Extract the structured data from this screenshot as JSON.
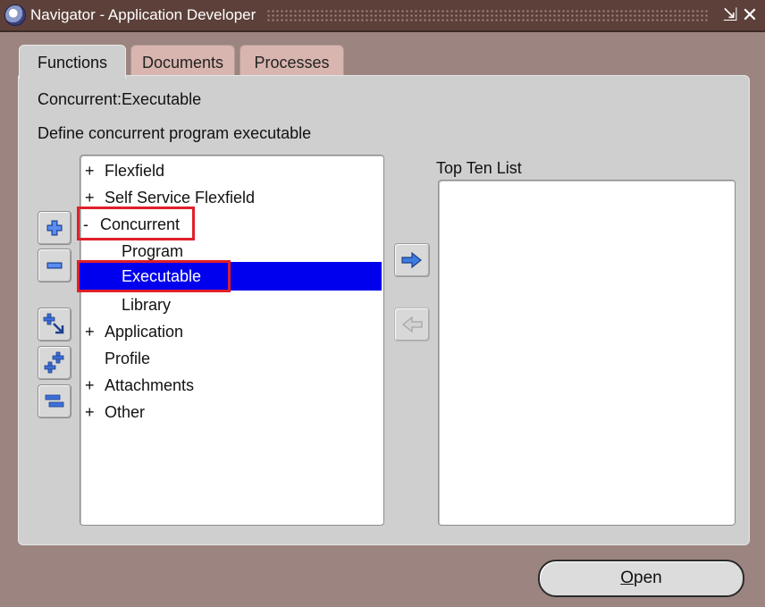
{
  "window": {
    "title": "Navigator - Application Developer",
    "minimize_glyph": "⇲",
    "close_glyph": "✕"
  },
  "tabs": [
    {
      "label": "Functions",
      "active": true
    },
    {
      "label": "Documents",
      "active": false
    },
    {
      "label": "Processes",
      "active": false
    }
  ],
  "function_name": "Concurrent:Executable",
  "function_description": "Define concurrent program executable",
  "tree": {
    "items": [
      {
        "prefix": "+",
        "label": "Flexfield",
        "level": 0
      },
      {
        "prefix": "+",
        "label": "Self Service Flexfield",
        "level": 0
      },
      {
        "prefix": "-",
        "label": "Concurrent",
        "level": 0,
        "highlighted": true
      },
      {
        "prefix": "",
        "label": "Program",
        "level": 1
      },
      {
        "prefix": "",
        "label": "Executable",
        "level": 1,
        "selected": true,
        "highlighted": true
      },
      {
        "prefix": "",
        "label": "Library",
        "level": 1
      },
      {
        "prefix": "+",
        "label": "Application",
        "level": 0
      },
      {
        "prefix": "",
        "label": "Profile",
        "level": 0
      },
      {
        "prefix": "+",
        "label": "Attachments",
        "level": 0
      },
      {
        "prefix": "+",
        "label": "Other",
        "level": 0
      }
    ]
  },
  "side_buttons": [
    {
      "name": "expand-button",
      "icon": "plus-icon"
    },
    {
      "name": "collapse-button",
      "icon": "minus-icon"
    },
    {
      "name": "expand-branch-button",
      "icon": "expand-branch-icon"
    },
    {
      "name": "expand-all-button",
      "icon": "expand-all-icon"
    },
    {
      "name": "collapse-all-button",
      "icon": "collapse-all-icon"
    }
  ],
  "top_ten": {
    "label": "Top Ten List",
    "items": []
  },
  "open_button": {
    "mnemonic": "O",
    "rest": "pen"
  },
  "colors": {
    "selection": "#0000ee",
    "highlight_box": "#e0202a",
    "window_bg": "#9c8580",
    "panel_bg": "#cfcfcf"
  }
}
